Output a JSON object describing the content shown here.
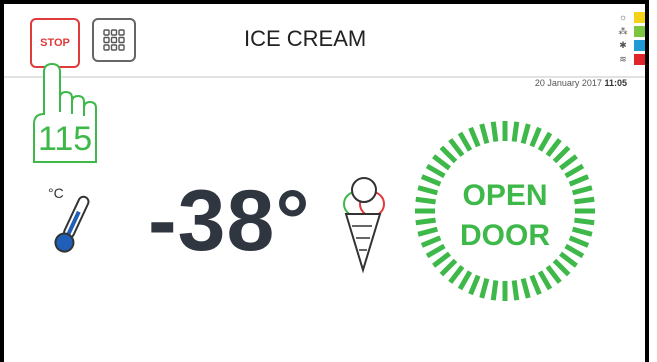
{
  "header": {
    "stop_label": "STOP",
    "title": "ICE CREAM",
    "date": "20 January 2017",
    "time": "11:05"
  },
  "status_indicators": [
    {
      "icon": "sun-icon",
      "color": "#f5d21a"
    },
    {
      "icon": "dots-icon",
      "color": "#7cc63f"
    },
    {
      "icon": "snowflake-icon",
      "color": "#1f9ad6"
    },
    {
      "icon": "heat-icon",
      "color": "#e0242a"
    }
  ],
  "touch_counter": "115",
  "temperature": {
    "unit": "°C",
    "value": "-38°"
  },
  "door_status": {
    "line1": "OPEN",
    "line2": "DOOR"
  },
  "colors": {
    "accent_green": "#3fb84a",
    "stop_red": "#e03a3a",
    "thermo_blue": "#1f5fb8"
  }
}
